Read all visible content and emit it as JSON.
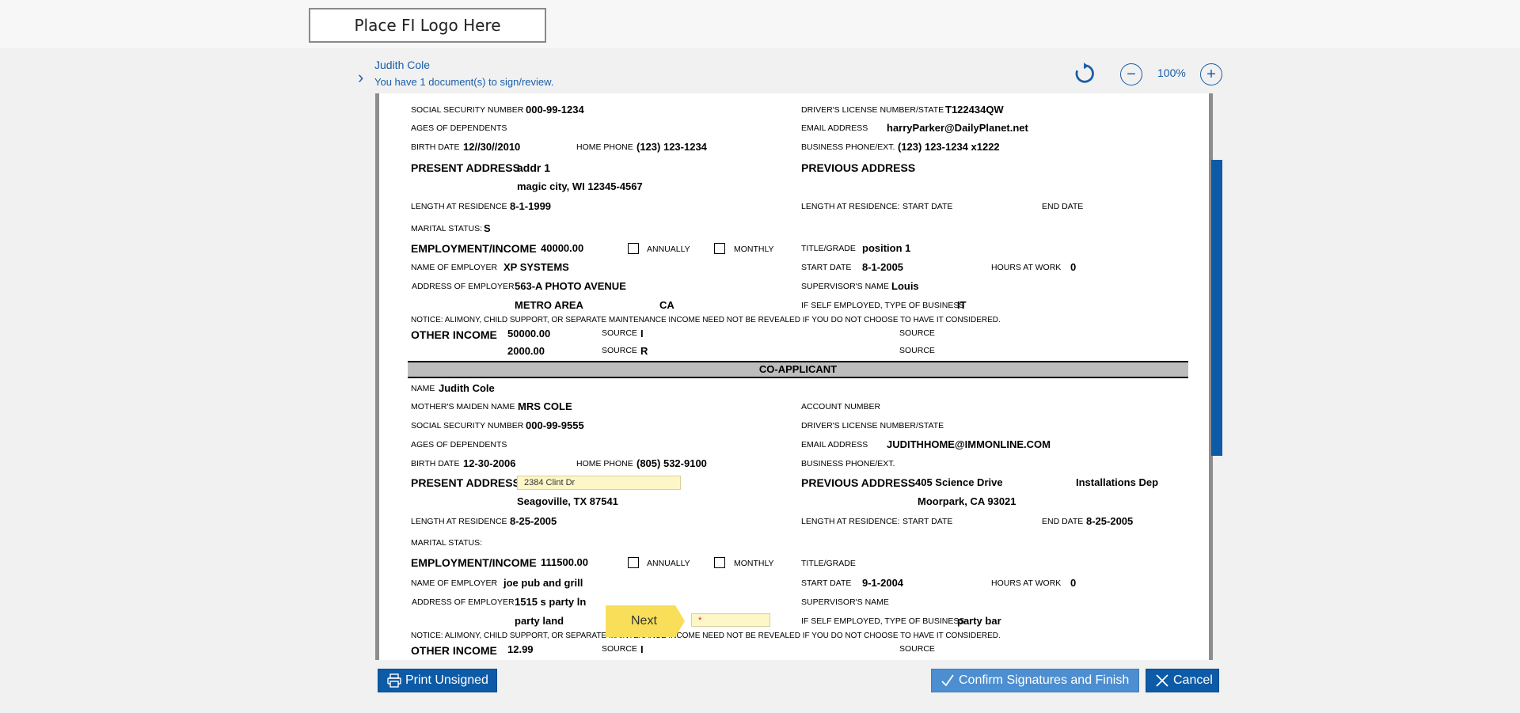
{
  "header": {
    "logo_text": "Place FI Logo Here"
  },
  "viewer": {
    "user_name": "Judith Cole",
    "doc_count": "You have 1 document(s) to sign/review.",
    "zoom_level": "100%"
  },
  "applicant": {
    "ssn_label": "SOCIAL SECURITY NUMBER",
    "ssn": "000-99-1234",
    "dl_label": "DRIVER'S LICENSE NUMBER/STATE",
    "dl": "T122434QW",
    "ages_label": "AGES OF DEPENDENTS",
    "email_label": "EMAIL ADDRESS",
    "email": "harryParker@DailyPlanet.net",
    "birth_label": "BIRTH DATE",
    "birth": "12//30//2010",
    "home_phone_label": "HOME PHONE",
    "home_phone": "(123) 123-1234",
    "biz_phone_label": "BUSINESS PHONE/EXT.",
    "biz_phone": "(123) 123-1234 x1222",
    "present_addr_label": "PRESENT ADDRESS",
    "present_addr": "addr 1",
    "present_addr2": "magic city, WI 12345-4567",
    "prev_addr_label": "PREVIOUS ADDRESS",
    "length_label": "LENGTH AT RESIDENCE",
    "length": "8-1-1999",
    "length_prev_label": "LENGTH AT RESIDENCE:",
    "start_date_label": "START DATE",
    "end_date_label": "END DATE",
    "marital_label": "MARITAL STATUS:",
    "marital": "S",
    "employment_label": "EMPLOYMENT/INCOME",
    "income": "40000.00",
    "annually_label": "ANNUALLY",
    "monthly_label": "MONTHLY",
    "title_label": "TITLE/GRADE",
    "title": "position 1",
    "employer_label": "NAME OF EMPLOYER",
    "employer": "XP SYSTEMS",
    "start_label": "START DATE",
    "start": "8-1-2005",
    "hours_label": "HOURS AT WORK",
    "hours": "0",
    "employer_addr_label": "ADDRESS OF EMPLOYER",
    "employer_addr": "563-A PHOTO AVENUE",
    "supervisor_label": "SUPERVISOR'S NAME",
    "supervisor": "Louis",
    "employer_city": "METRO AREA",
    "employer_state": "CA",
    "self_emp_label": "IF SELF EMPLOYED, TYPE OF BUSINESS",
    "self_emp": "IT",
    "notice": "NOTICE: ALIMONY, CHILD SUPPORT, OR SEPARATE MAINTENANCE INCOME NEED NOT BE REVEALED IF YOU DO NOT CHOOSE TO HAVE IT CONSIDERED.",
    "other_income_label": "OTHER INCOME",
    "other1": "50000.00",
    "source_label": "SOURCE",
    "source1": "I",
    "other2": "2000.00",
    "source2": "R"
  },
  "coapplicant": {
    "section_title": "CO-APPLICANT",
    "name_label": "NAME",
    "name": "Judith Cole",
    "maiden_label": "MOTHER'S MAIDEN NAME",
    "maiden": "MRS COLE",
    "account_label": "ACCOUNT NUMBER",
    "ssn_label": "SOCIAL SECURITY NUMBER",
    "ssn": "000-99-9555",
    "dl_label": "DRIVER'S LICENSE NUMBER/STATE",
    "ages_label": "AGES OF DEPENDENTS",
    "email_label": "EMAIL ADDRESS",
    "email": "JUDITHHOME@IMMONLINE.COM",
    "birth_label": "BIRTH DATE",
    "birth": "12-30-2006",
    "home_phone_label": "HOME PHONE",
    "home_phone": "(805) 532-9100",
    "biz_phone_label": "BUSINESS PHONE/EXT.",
    "present_addr_label": "PRESENT ADDRESS",
    "present_addr_input": "2384 Clint Dr",
    "present_addr2": "Seagoville, TX 87541",
    "prev_addr_label": "PREVIOUS ADDRESS",
    "prev_addr": "405 Science Drive",
    "prev_addr_extra": "Installations Dep",
    "prev_addr2": "Moorpark, CA 93021",
    "length_label": "LENGTH AT RESIDENCE",
    "length": "8-25-2005",
    "length_prev_label": "LENGTH AT RESIDENCE:",
    "start_date_label": "START DATE",
    "end_date_label": "END DATE",
    "end_date": "8-25-2005",
    "marital_label": "MARITAL STATUS:",
    "employment_label": "EMPLOYMENT/INCOME",
    "income": "111500.00",
    "annually_label": "ANNUALLY",
    "monthly_label": "MONTHLY",
    "title_label": "TITLE/GRADE",
    "employer_label": "NAME OF EMPLOYER",
    "employer": "joe pub and grill",
    "start_label": "START DATE",
    "start": "9-1-2004",
    "hours_label": "HOURS AT WORK",
    "hours": "0",
    "employer_addr_label": "ADDRESS OF EMPLOYER",
    "employer_addr": "1515 s party ln",
    "supervisor_label": "SUPERVISOR'S NAME",
    "employer_city": "party land",
    "required_marker": "*",
    "self_emp_label": "IF SELF EMPLOYED, TYPE OF BUSINESS",
    "self_emp": "party bar",
    "notice": "NOTICE: ALIMONY, CHILD SUPPORT, OR SEPARATE MAINTENANCE INCOME NEED NOT BE REVEALED IF YOU DO NOT CHOOSE TO HAVE IT CONSIDERED.",
    "other_income_label": "OTHER INCOME",
    "other1": "12.99",
    "source_label": "SOURCE",
    "source1": "I"
  },
  "next_label": "Next",
  "footer": {
    "print_label": "Print Unsigned",
    "confirm_label": "Confirm Signatures and Finish",
    "cancel_label": "Cancel"
  },
  "colors": {
    "accent": "#0d5aa7",
    "confirm": "#4d8ed0",
    "next": "#f8de59",
    "input": "#fdf6c6"
  }
}
